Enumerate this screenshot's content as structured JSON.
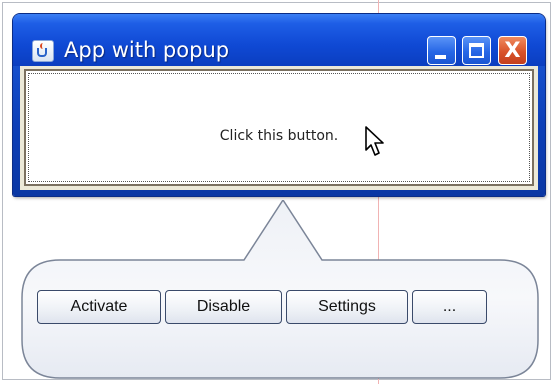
{
  "window": {
    "title": "App with popup",
    "icon": "java-coffee-cup-icon",
    "controls": [
      "minimize",
      "maximize",
      "close"
    ],
    "close_glyph": "X",
    "main_button_label": "Click this button."
  },
  "popup": {
    "buttons": [
      {
        "label": "Activate"
      },
      {
        "label": "Disable"
      },
      {
        "label": "Settings"
      },
      {
        "label": "..."
      }
    ]
  },
  "colors": {
    "titlebar": "#0f49d4",
    "close_button": "#d9532a",
    "window_frame": "#0a37a4"
  }
}
